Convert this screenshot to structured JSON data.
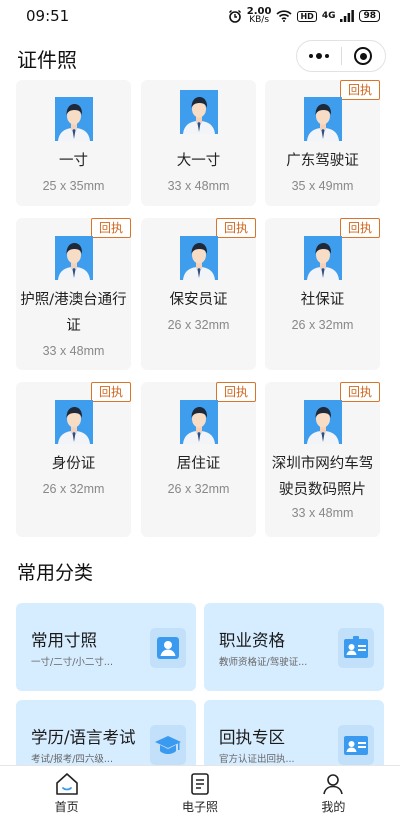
{
  "status_bar": {
    "time": "09:51",
    "speed_value": "2.00",
    "speed_unit": "KB/s",
    "hd": "HD",
    "signal": "4G",
    "battery": "98"
  },
  "header": {
    "title": "证件照"
  },
  "photo_items": [
    {
      "name": "一寸",
      "size": "25 x 35mm",
      "badge": ""
    },
    {
      "name": "大一寸",
      "size": "33 x 48mm",
      "badge": ""
    },
    {
      "name": "广东驾驶证",
      "size": "35 x 49mm",
      "badge": "回执"
    },
    {
      "name_line1": "护照/港澳台通行",
      "name_line2": "证",
      "size": "33 x 48mm",
      "badge": "回执"
    },
    {
      "name": "保安员证",
      "size": "26 x 32mm",
      "badge": "回执"
    },
    {
      "name": "社保证",
      "size": "26 x 32mm",
      "badge": "回执"
    },
    {
      "name": "身份证",
      "size": "26 x 32mm",
      "badge": "回执"
    },
    {
      "name": "居住证",
      "size": "26 x 32mm",
      "badge": "回执"
    },
    {
      "name_line1": "深圳市网约车驾",
      "name_line2": "驶员数码照片",
      "size": "33 x 48mm",
      "badge": "回执"
    }
  ],
  "categories_section": {
    "title": "常用分类"
  },
  "categories": [
    {
      "title": "常用寸照",
      "subtitle": "一寸/二寸/小二寸...",
      "icon": "portrait-icon"
    },
    {
      "title": "职业资格",
      "subtitle": "教师资格证/驾驶证...",
      "icon": "id-card-icon"
    },
    {
      "title": "学历/语言考试",
      "subtitle": "考试/报考/四六级...",
      "icon": "graduation-cap-icon"
    },
    {
      "title": "回执专区",
      "subtitle": "官方认证出回执...",
      "icon": "id-card-icon"
    }
  ],
  "tabbar": [
    {
      "label": "首页",
      "icon": "home-icon"
    },
    {
      "label": "电子照",
      "icon": "document-icon"
    },
    {
      "label": "我的",
      "icon": "user-icon"
    }
  ],
  "colors": {
    "accent_blue": "#3e9ded",
    "badge_orange": "#d0671f",
    "tile_bg": "#d6ecff",
    "card_bg": "#f6f6f6"
  }
}
